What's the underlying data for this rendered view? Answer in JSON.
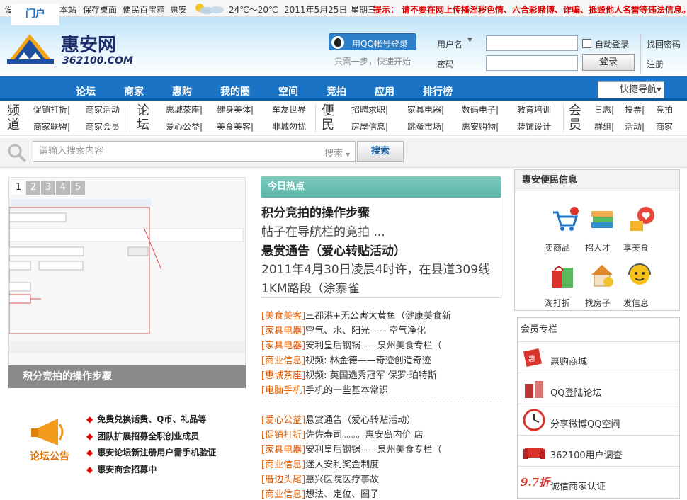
{
  "topbar": {
    "links": [
      "设为首页",
      "收藏本站",
      "保存桌面",
      "便民百宝箱"
    ],
    "city": "惠安",
    "temp": "24℃～20℃",
    "date": "2011年5月25日",
    "weekday": "星期三",
    "tip_label": "提示：",
    "tip_text": "请不要在网上传播淫秽色情、六合彩赌博、诈骗、抵毁他人名誉等违法信息。"
  },
  "header": {
    "logo_cn": "惠安网",
    "logo_en": "362100.COM",
    "qq_login": "用QQ帐号登录",
    "qq_sub": "只需一步，快速开始",
    "user_label": "用户名",
    "pwd_label": "密码",
    "auto_login": "自动登录",
    "login_btn": "登录",
    "find_pwd": "找回密码",
    "register": "注册"
  },
  "nav": {
    "items": [
      "门户",
      "论坛",
      "商家",
      "惠购",
      "我的圈",
      "空间",
      "竞拍",
      "应用",
      "排行榜"
    ],
    "quick": "快捷导航"
  },
  "subnav": {
    "groups": [
      {
        "title": [
          "频",
          "道"
        ],
        "rows": [
          [
            "促销打折|",
            "商家活动"
          ],
          [
            "商家联盟|",
            "商家会员"
          ]
        ]
      },
      {
        "title": [
          "论",
          "坛"
        ],
        "rows": [
          [
            "惠城茶座|",
            "健身美体|",
            "车友世界"
          ],
          [
            "爱心公益|",
            "美食美客|",
            "非城勿扰"
          ]
        ]
      },
      {
        "title": [
          "便",
          "民"
        ],
        "rows": [
          [
            "招聘求职|",
            "家具电器|",
            "数码电子|",
            "教育培训"
          ],
          [
            "房屋信息|",
            "跳蚤市场|",
            "惠安购物|",
            "装饰设计"
          ]
        ]
      },
      {
        "title": [
          "会",
          "员"
        ],
        "rows": [
          [
            "日志|",
            "投票|",
            "竞拍"
          ],
          [
            "群组|",
            "活动|",
            "商家"
          ]
        ]
      }
    ]
  },
  "search": {
    "placeholder": "请输入搜索内容",
    "select": "搜索",
    "btn": "搜索"
  },
  "slideshow": {
    "tabs": [
      "1",
      "2",
      "3",
      "4",
      "5"
    ],
    "caption": "积分竞拍的操作步骤"
  },
  "notices": {
    "items": [
      "免费兑换话费、Q币、礼品等",
      "团队扩展招募全职创业成员",
      "惠安论坛新注册用户需手机验证",
      "惠安商会招募中"
    ]
  },
  "hot": {
    "head": "今日热点",
    "h1": "积分竞拍的操作步骤",
    "d1": "帖子在导航栏的竞拍 ...",
    "h2": "悬赏通告（爱心转贴活动）",
    "d2a": "2011年4月30日凌晨4时许，在县道309线",
    "d2b": "1KM路段（涂寨雀"
  },
  "news1": [
    {
      "tag": "[美食美客]",
      "text": "三都港+无公害大黄鱼（健康美食新"
    },
    {
      "tag": "[家具电器]",
      "text": "空气、水、阳光 ---- 空气净化"
    },
    {
      "tag": "[家具电器]",
      "text": "安利皇后钢锅-----泉州美食专栏（"
    },
    {
      "tag": "[商业信息]",
      "text": "视频: 林金德——奇迹创造奇迹"
    },
    {
      "tag": "[惠城茶座]",
      "text": "视频: 英国选秀冠军 保罗·珀特斯"
    },
    {
      "tag": "[电脑手机]",
      "text": "手机的一些基本常识"
    }
  ],
  "news2": [
    {
      "tag": "[爱心公益]",
      "text": "悬赏通告（爱心转贴活动）"
    },
    {
      "tag": "[促销打折]",
      "text": "佐佐寿司。。。。惠安岛内价 店"
    },
    {
      "tag": "[家具电器]",
      "text": "安利皇后钢锅-----泉州美食专栏（"
    },
    {
      "tag": "[商业信息]",
      "text": "迷人安利奖金制度"
    },
    {
      "tag": "[厝边头尾]",
      "text": "惠兴医院医疗事故"
    },
    {
      "tag": "[商业信息]",
      "text": "想法、定位、圈子"
    }
  ],
  "bianmin": {
    "head": "惠安便民信息",
    "items": [
      "卖商品",
      "招人才",
      "享美食",
      "淘打折",
      "找房子",
      "发信息"
    ]
  },
  "member": {
    "head": "会员专栏",
    "items": [
      "惠购商城",
      "QQ登陆论坛",
      "分享微博QQ空间",
      "362100用户调查",
      "诚信商家认证"
    ],
    "badge": "9.7折"
  },
  "colors": {
    "nav": "#1a73c4",
    "tag": "#e05a00",
    "hot": "#5bb5a8",
    "tip": "#d00000"
  }
}
